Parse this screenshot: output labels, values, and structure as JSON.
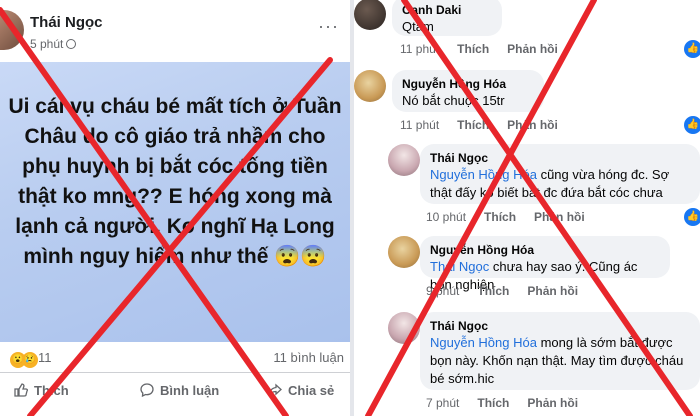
{
  "post": {
    "author": "Thái Ngọc",
    "time": "5 phút",
    "text": "Ui cái vụ cháu bé mất tích ở Tuần Châu do cô giáo trả nhầm cho phụ huynh bị bắt cóc tống tiền thật ko mng?? E hóng xong mà lạnh cả người. Ko nghĩ Hạ Long mình nguy hiểm như thế 😨😨",
    "reaction_count": "11",
    "comment_count": "11 bình luận",
    "actions": {
      "like": "Thích",
      "comment": "Bình luận",
      "share": "Chia sẻ"
    }
  },
  "comments": [
    {
      "name": "Oanh Daki",
      "text": "Qtam",
      "time": "11 phút",
      "like": "Thích",
      "reply": "Phản hồi"
    },
    {
      "name": "Nguyễn Hồng Hóa",
      "text": "Nó bắt chuộc 15tr",
      "time": "11 phút",
      "like": "Thích",
      "reply": "Phản hồi"
    },
    {
      "name": "Thái Ngọc",
      "tag": "Nguyễn Hồng Hóa",
      "text": " cũng vừa hóng đc. Sợ thật đấy ko biết bắt đc đứa bắt cóc chưa",
      "time": "10 phút",
      "like": "Thích",
      "reply": "Phản hồi"
    },
    {
      "name": "Nguyễn Hồng Hóa",
      "tag": "Thái Ngọc",
      "text": " chưa hay sao ý. Cũng ác bọn nghiện",
      "time": "9 phút",
      "like": "Thích",
      "reply": "Phản hồi"
    },
    {
      "name": "Thái Ngọc",
      "tag": "Nguyễn Hồng Hóa",
      "text": " mong là sớm bắt được bọn này. Khốn nạn thật. May tìm được cháu bé sớm.hic",
      "time": "7 phút",
      "like": "Thích",
      "reply": "Phản hồi"
    }
  ],
  "colors": {
    "cross": "#e8262b",
    "link": "#216fdb",
    "card": "#b9cdf0"
  }
}
